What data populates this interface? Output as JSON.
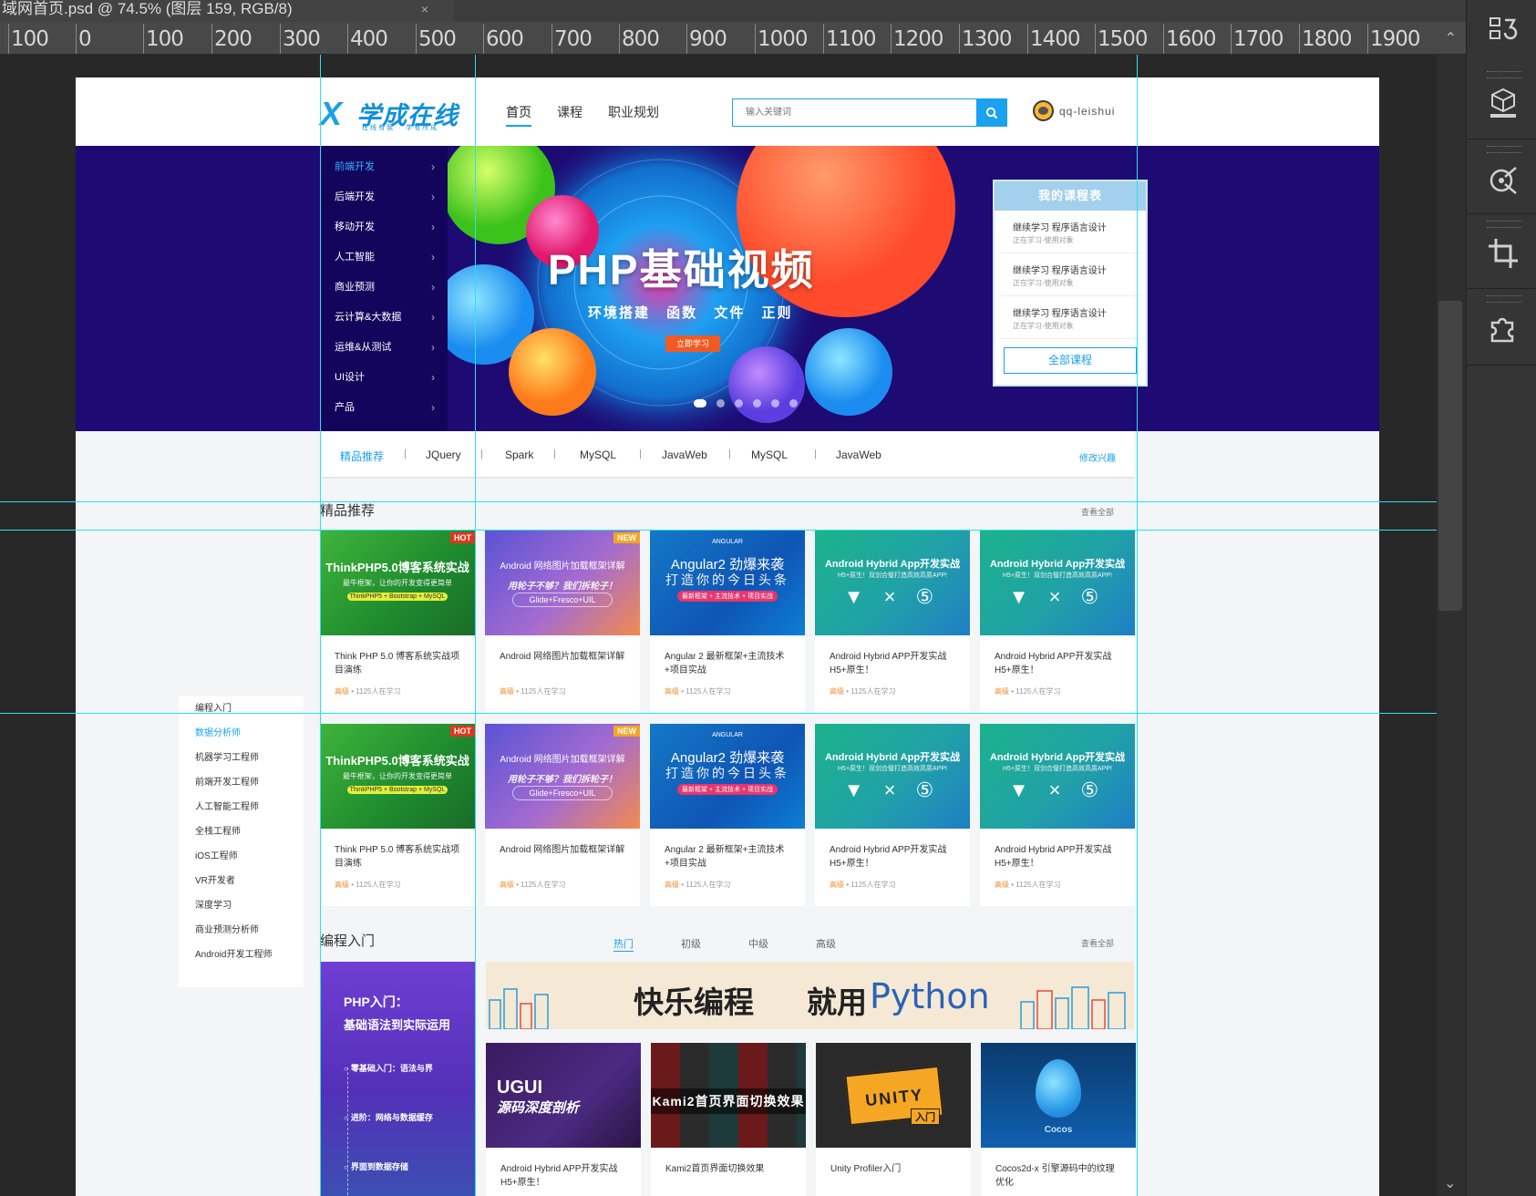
{
  "ps": {
    "tab_title": "域网首页.psd @ 74.5% (图层 159, RGB/8)",
    "tab_close": "×",
    "ruler_labels": [
      "100",
      "0",
      "100",
      "200",
      "300",
      "400",
      "500",
      "600",
      "700",
      "800",
      "900",
      "1000",
      "1100",
      "1200",
      "1300",
      "1400",
      "1500",
      "1600",
      "1700",
      "1800",
      "1900"
    ],
    "ruler_up_arrow": "⌃",
    "scroll_down_arrow": "⌄",
    "panel_icons": [
      "history-panel-icon",
      "3d-panel-icon",
      "paths-panel-icon",
      "crop-panel-icon",
      "plugins-panel-icon"
    ]
  },
  "header": {
    "logo_mark": "X",
    "logo_name": "学成在线",
    "logo_slogan": "在线有我 · 学有所成",
    "nav": [
      "首页",
      "课程",
      "职业规划"
    ],
    "search_placeholder": "输入关键词",
    "username": "qq-leishui"
  },
  "banner": {
    "menu": [
      "前端开发",
      "后端开发",
      "移动开发",
      "人工智能",
      "商业预测",
      "云计算&大数据",
      "运维&从测试",
      "UI设计",
      "产品"
    ],
    "arrow": "›",
    "title": "PHP基础视频",
    "subtitle": "环境搭建 函数 文件 正则",
    "cta": "立即学习",
    "schedule": {
      "title": "我的课程表",
      "items": [
        {
          "title": "继续学习 程序语言设计",
          "sub": "正在学习-使用对象"
        },
        {
          "title": "继续学习 程序语言设计",
          "sub": "正在学习-使用对象"
        },
        {
          "title": "继续学习 程序语言设计",
          "sub": "正在学习-使用对象"
        }
      ],
      "button": "全部课程"
    }
  },
  "tags": {
    "items": [
      "精品推荐",
      "JQuery",
      "Spark",
      "MySQL",
      "JavaWeb",
      "MySQL",
      "JavaWeb"
    ],
    "separator": "|",
    "edit": "修改兴趣"
  },
  "featured": {
    "title": "精品推荐",
    "see_all": "查看全部",
    "thumbs": [
      {
        "badge": "HOT",
        "head": "ThinkPHP5.0博客系统实战",
        "sub": "最牛框架，让你的开发变得更简单",
        "tag": "ThinkPHP5 + Bootstrap + MySQL"
      },
      {
        "badge": "NEW",
        "head": "Android 网络图片加载框架详解",
        "sub": "用轮子不够？我们拆轮子！",
        "tag": "Glide+Fresco+UIL"
      },
      {
        "logo": "ANGULAR",
        "head": "Angular2 劲爆来袭",
        "sub": "打造你的今日头条",
        "tag": "最新框架 + 主流技术 + 项目实战"
      },
      {
        "head": "Android Hybrid App开发实战",
        "sub": "H5+原生！双剑合璧打造高效高质APP!",
        "icons": "🤖×5"
      },
      {
        "head": "Android Hybrid App开发实战",
        "sub": "H5+原生！双剑合璧打造高效高质APP!",
        "icons": "🤖×5"
      }
    ],
    "cards": [
      {
        "title": "Think PHP 5.0 博客系统实战项目演练",
        "level": "高级",
        "learners": "1125人在学习"
      },
      {
        "title": "Android 网络图片加载框架详解",
        "level": "高级",
        "learners": "1125人在学习"
      },
      {
        "title": "Angular 2 最新框架+主流技术+项目实战",
        "level": "高级",
        "learners": "1125人在学习"
      },
      {
        "title": "Android Hybrid APP开发实战 H5+原生！",
        "level": "高级",
        "learners": "1125人在学习"
      },
      {
        "title": "Android Hybrid APP开发实战 H5+原生！",
        "level": "高级",
        "learners": "1125人在学习"
      }
    ],
    "dot": "•"
  },
  "float_list": [
    "编程入门",
    "数据分析师",
    "机器学习工程师",
    "前端开发工程师",
    "人工智能工程师",
    "全栈工程师",
    "iOS工程师",
    "VR开发者",
    "深度学习",
    "商业预测分析师",
    "Android开发工程师"
  ],
  "programming": {
    "title": "编程入门",
    "tabs": [
      "热门",
      "初级",
      "中级",
      "高级"
    ],
    "see_all": "查看全部",
    "promo": {
      "t1": "PHP入门：",
      "t2": "基础语法到实际运用",
      "steps": [
        "零基础入门：语法与界",
        "进阶：网络与数据缓存",
        "界面到数据存储"
      ]
    },
    "python_banner": {
      "a": "快乐编程",
      "b": "就用",
      "c": "Python"
    },
    "thumbs": [
      {
        "t1": "UGUI",
        "t2": "源码深度剖析"
      },
      {
        "t1": "Kami2首页界面切换效果"
      },
      {
        "t1": "UNITY",
        "t2": "入门"
      },
      {
        "t1": "Cocos"
      }
    ],
    "cards": [
      {
        "title": "Android Hybrid APP开发实战 H5+原生！"
      },
      {
        "title": "Kami2首页界面切换效果"
      },
      {
        "title": "Unity Profiler入门"
      },
      {
        "title": "Cocos2d-x 引擎源码中的纹理优化"
      }
    ]
  },
  "colors": {
    "accent": "#1aa1f0",
    "banner_bg": "#1d0a73",
    "guide": "#26e4f0",
    "level": "#f08a2c"
  }
}
